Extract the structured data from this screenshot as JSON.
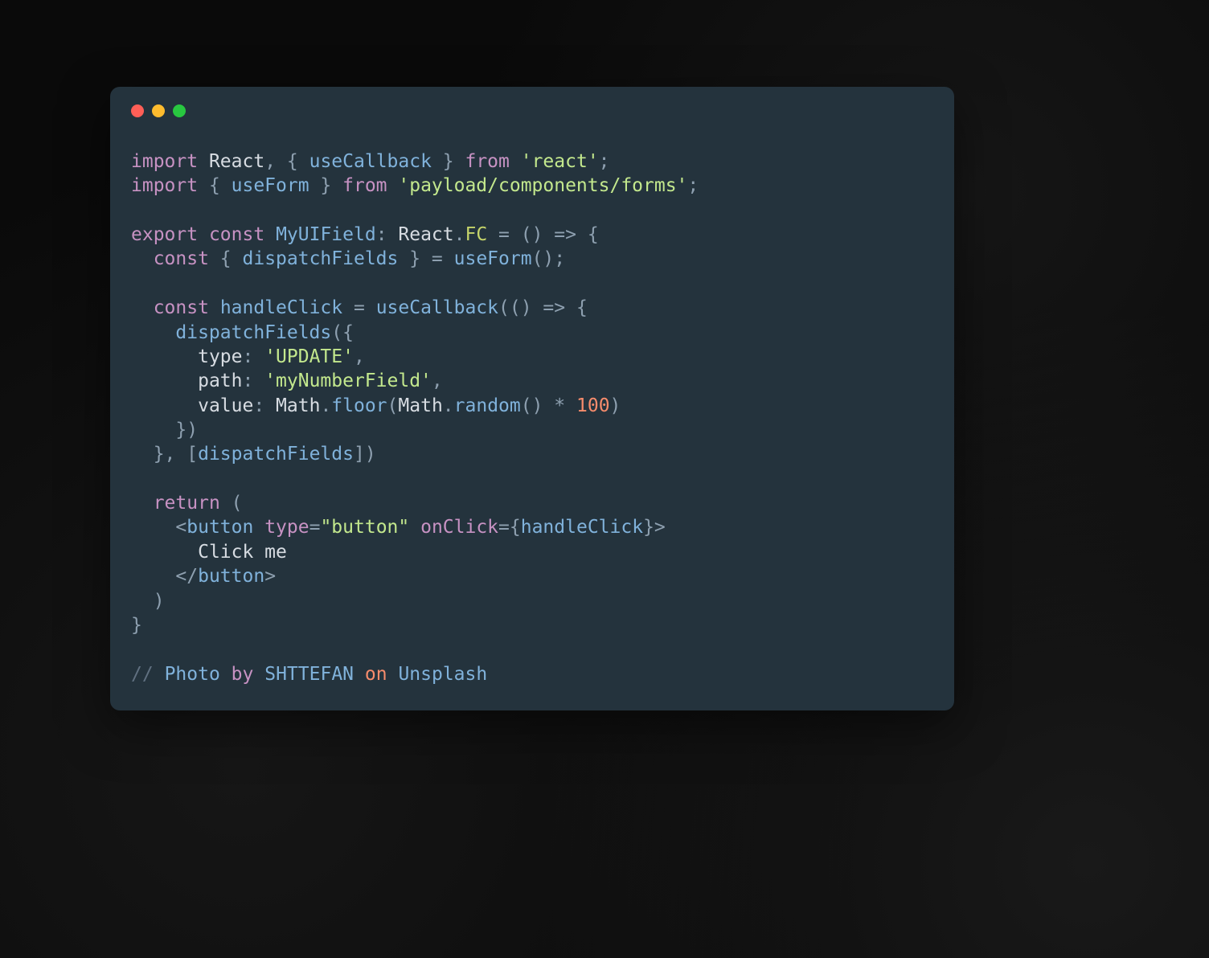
{
  "window": {
    "traffic_lights": {
      "red": "#ff5f57",
      "yellow": "#febc2e",
      "green": "#28c840"
    }
  },
  "code": {
    "line1": {
      "import": "import",
      "react": "React",
      "comma": ",",
      "lbrace": " { ",
      "useCallback": "useCallback",
      "rbrace": " } ",
      "from": "from",
      "module": "'react'",
      "semi": ";"
    },
    "line2": {
      "import": "import",
      "lbrace": " { ",
      "useForm": "useForm",
      "rbrace": " } ",
      "from": "from",
      "module": "'payload/components/forms'",
      "semi": ";"
    },
    "line4": {
      "export": "export",
      "const": "const",
      "name": "MyUIField",
      "colon": ": ",
      "reactType": "React",
      "dot": ".",
      "fc": "FC",
      "eq": " = () => {"
    },
    "line5": {
      "indent": "  ",
      "const": "const",
      "lbrace": " { ",
      "dispatchFields": "dispatchFields",
      "rbrace": " } = ",
      "useForm": "useForm",
      "call": "();"
    },
    "line7": {
      "indent": "  ",
      "const": "const",
      "space": " ",
      "handleClick": "handleClick",
      "eq": " = ",
      "useCallback": "useCallback",
      "open": "(() => {"
    },
    "line8": {
      "indent": "    ",
      "dispatchFields": "dispatchFields",
      "open": "({"
    },
    "line9": {
      "indent": "      ",
      "type": "type",
      "colon": ": ",
      "value": "'UPDATE'",
      "comma": ","
    },
    "line10": {
      "indent": "      ",
      "path": "path",
      "colon": ": ",
      "value": "'myNumberField'",
      "comma": ","
    },
    "line11": {
      "indent": "      ",
      "valueKey": "value",
      "colon": ": ",
      "math1": "Math",
      "dot1": ".",
      "floor": "floor",
      "lparen": "(",
      "math2": "Math",
      "dot2": ".",
      "random": "random",
      "randcall": "() * ",
      "hundred": "100",
      "rparen": ")"
    },
    "line12": {
      "indent": "    ",
      "close": "})"
    },
    "line13": {
      "indent": "  ",
      "closeFn": "}, [",
      "dispatchFields": "dispatchFields",
      "closeArr": "])"
    },
    "line15": {
      "indent": "  ",
      "return": "return",
      "open": " ("
    },
    "line16": {
      "indent": "    ",
      "open": "<",
      "button": "button",
      "space1": " ",
      "typeAttr": "type",
      "eq1": "=",
      "typeVal": "\"button\"",
      "space2": " ",
      "onClick": "onClick",
      "eq2": "={",
      "handleClick": "handleClick",
      "close": "}>"
    },
    "line17": {
      "indent": "      ",
      "text": "Click me"
    },
    "line18": {
      "indent": "    ",
      "open": "</",
      "button": "button",
      "close": ">"
    },
    "line19": {
      "indent": "  ",
      "close": ")"
    },
    "line20": {
      "close": "}"
    },
    "line22": {
      "slashes": "//",
      "space1": " ",
      "photo": "Photo",
      "space2": " ",
      "by": "by",
      "space3": " ",
      "author": "SHTTEFAN",
      "space4": " ",
      "on": "on",
      "space5": " ",
      "unsplash": "Unsplash"
    }
  }
}
